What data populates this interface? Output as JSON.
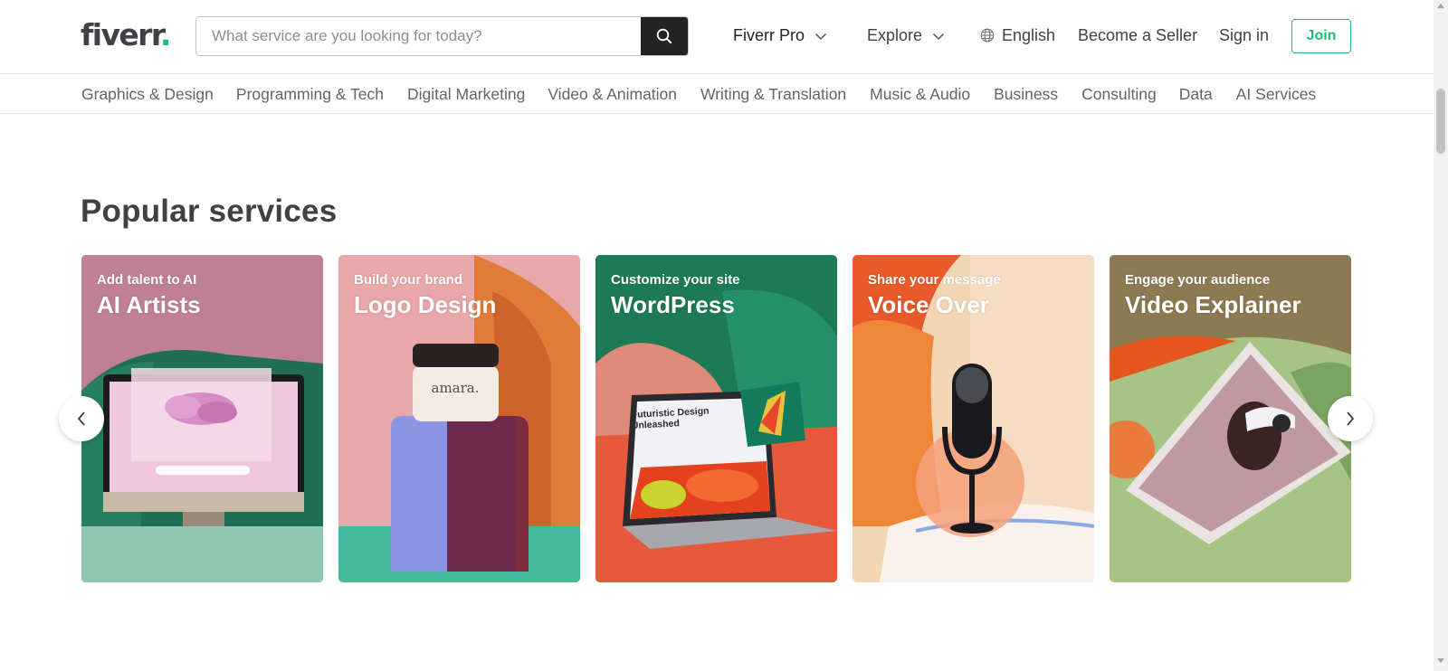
{
  "header": {
    "logo_text": "fiverr",
    "logo_dot": ".",
    "search_placeholder": "What service are you looking for today?",
    "nav": {
      "pro": "Fiverr Pro",
      "explore": "Explore",
      "language": "English",
      "become_seller": "Become a Seller",
      "sign_in": "Sign in",
      "join": "Join"
    }
  },
  "categories": [
    "Graphics & Design",
    "Programming & Tech",
    "Digital Marketing",
    "Video & Animation",
    "Writing & Translation",
    "Music & Audio",
    "Business",
    "Consulting",
    "Data",
    "AI Services"
  ],
  "section": {
    "title": "Popular services"
  },
  "cards": [
    {
      "subtitle": "Add talent to AI",
      "title": "AI Artists",
      "image": "monitor-with-pink-cloud"
    },
    {
      "subtitle": "Build your brand",
      "title": "Logo Design",
      "image": "amara-jar-on-pedestal",
      "image_text": "amara."
    },
    {
      "subtitle": "Customize your site",
      "title": "WordPress",
      "image": "laptop-website",
      "image_text": "Futuristic Design Unleashed"
    },
    {
      "subtitle": "Share your message",
      "title": "Voice Over",
      "image": "studio-microphone"
    },
    {
      "subtitle": "Engage your audience",
      "title": "Video Explainer",
      "image": "tablet-vr-headset"
    }
  ],
  "colors": {
    "brand_green": "#1dbf73",
    "text_dark": "#404145",
    "text_muted": "#62646a",
    "search_button": "#222325"
  },
  "icons": {
    "search": "search-icon",
    "chevron": "chevron-down-icon",
    "globe": "globe-icon",
    "prev": "chevron-left-icon",
    "next": "chevron-right-icon"
  }
}
